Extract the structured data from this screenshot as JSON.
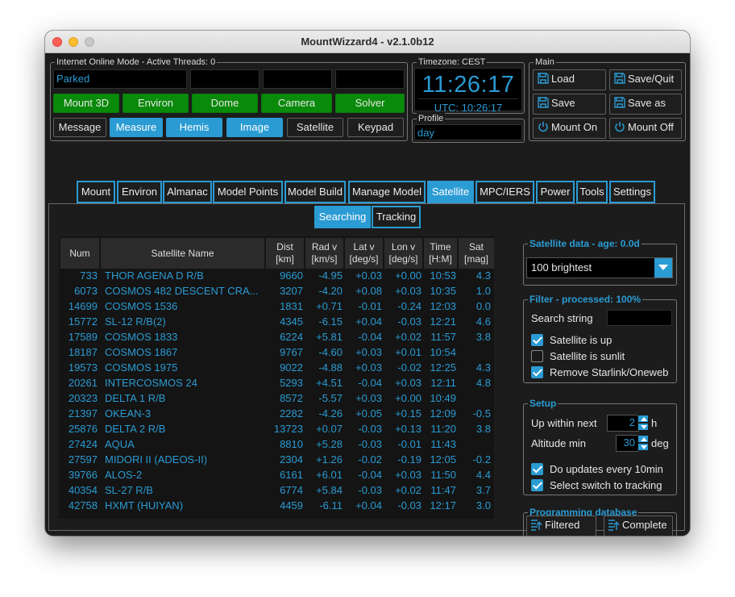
{
  "window": {
    "title": "MountWizzard4 - v2.1.0b12"
  },
  "internet": {
    "label": "Internet Online Mode  -  Active Threads:  0",
    "status": "Parked",
    "devices": [
      "Mount 3D",
      "Environ",
      "Dome",
      "Camera",
      "Solver"
    ],
    "actions": [
      {
        "label": "Message",
        "state": "normal"
      },
      {
        "label": "Measure",
        "state": "active"
      },
      {
        "label": "Hemis",
        "state": "active"
      },
      {
        "label": "Image",
        "state": "active"
      },
      {
        "label": "Satellite",
        "state": "normal"
      },
      {
        "label": "Keypad",
        "state": "normal"
      }
    ]
  },
  "timezone": {
    "label": "Timezone: CEST",
    "time": "11:26:17",
    "utc": "UTC:  10:26:17"
  },
  "profile": {
    "label": "Profile",
    "value": "day"
  },
  "main": {
    "label": "Main",
    "buttons": [
      {
        "label": "Load",
        "icon": "floppy-icon"
      },
      {
        "label": "Save/Quit",
        "icon": "floppy-icon"
      },
      {
        "label": "Save",
        "icon": "floppy-icon"
      },
      {
        "label": "Save as",
        "icon": "floppy-icon"
      },
      {
        "label": "Mount On",
        "icon": "power-icon"
      },
      {
        "label": "Mount Off",
        "icon": "power-icon"
      }
    ]
  },
  "tabs": [
    "Mount",
    "Environ",
    "Almanac",
    "Model Points",
    "Model Build",
    "Manage Model",
    "Satellite",
    "MPC/IERS",
    "Power",
    "Tools",
    "Settings"
  ],
  "active_tab": "Satellite",
  "subtabs": [
    "Searching",
    "Tracking"
  ],
  "active_subtab": "Searching",
  "table": {
    "headers": [
      "Num",
      "Satellite Name",
      "Dist\n[km]",
      "Rad v\n[km/s]",
      "Lat v\n[deg/s]",
      "Lon v\n[deg/s]",
      "Time\n[H:M]",
      "Sat\n[mag]"
    ],
    "rows": [
      [
        "733",
        "THOR AGENA D R/B",
        "9660",
        "-4.95",
        "+0.03",
        "+0.00",
        "10:53",
        "4.3"
      ],
      [
        "6073",
        "COSMOS 482 DESCENT CRA...",
        "3207",
        "-4.20",
        "+0.08",
        "+0.03",
        "10:35",
        "1.0"
      ],
      [
        "14699",
        "COSMOS 1536",
        "1831",
        "+0.71",
        "-0.01",
        "-0.24",
        "12:03",
        "0.0"
      ],
      [
        "15772",
        "SL-12 R/B(2)",
        "4345",
        "-6.15",
        "+0.04",
        "-0.03",
        "12:21",
        "4.6"
      ],
      [
        "17589",
        "COSMOS 1833",
        "6224",
        "+5.81",
        "-0.04",
        "+0.02",
        "11:57",
        "3.8"
      ],
      [
        "18187",
        "COSMOS 1867",
        "9767",
        "-4.60",
        "+0.03",
        "+0.01",
        "10:54",
        ""
      ],
      [
        "19573",
        "COSMOS 1975",
        "9022",
        "-4.88",
        "+0.03",
        "-0.02",
        "12:25",
        "4.3"
      ],
      [
        "20261",
        "INTERCOSMOS 24",
        "5293",
        "+4.51",
        "-0.04",
        "+0.03",
        "12:11",
        "4.8"
      ],
      [
        "20323",
        "DELTA 1 R/B",
        "8572",
        "-5.57",
        "+0.03",
        "+0.00",
        "10:49",
        ""
      ],
      [
        "21397",
        "OKEAN-3",
        "2282",
        "-4.26",
        "+0.05",
        "+0.15",
        "12:09",
        "-0.5"
      ],
      [
        "25876",
        "DELTA 2 R/B",
        "13723",
        "+0.07",
        "-0.03",
        "+0.13",
        "11:20",
        "3.8"
      ],
      [
        "27424",
        "AQUA",
        "8810",
        "+5.28",
        "-0.03",
        "-0.01",
        "11:43",
        ""
      ],
      [
        "27597",
        "MIDORI II (ADEOS-II)",
        "2304",
        "+1.26",
        "-0.02",
        "-0.19",
        "12:05",
        "-0.2"
      ],
      [
        "39766",
        "ALOS-2",
        "6161",
        "+6.01",
        "-0.04",
        "+0.03",
        "11:50",
        "4.4"
      ],
      [
        "40354",
        "SL-27 R/B",
        "6774",
        "+5.84",
        "-0.03",
        "+0.02",
        "11:47",
        "3.7"
      ],
      [
        "42758",
        "HXMT (HUIYAN)",
        "4459",
        "-6.11",
        "+0.04",
        "-0.03",
        "12:17",
        "3.0"
      ]
    ]
  },
  "satdata": {
    "label": "Satellite data - age: 0.0d",
    "selected": "100 brightest"
  },
  "filter": {
    "label": "Filter - processed: 100%",
    "search_label": "Search string",
    "search_value": "",
    "options": [
      {
        "label": "Satellite is up",
        "checked": true
      },
      {
        "label": "Satellite is sunlit",
        "checked": false
      },
      {
        "label": "Remove Starlink/Oneweb",
        "checked": true
      }
    ]
  },
  "setup": {
    "label": "Setup",
    "up_within_label": "Up within next",
    "up_within_value": "2",
    "up_within_unit": "h",
    "altitude_label": "Altitude min",
    "altitude_value": "30",
    "altitude_unit": "deg",
    "options": [
      {
        "label": "Do updates every 10min",
        "checked": true
      },
      {
        "label": "Select switch to tracking",
        "checked": true
      }
    ]
  },
  "programming": {
    "label": "Programming database",
    "filtered_label": "Filtered",
    "complete_label": "Complete"
  },
  "colors": {
    "accent": "#2a9bd3",
    "green": "#0a8a0a",
    "background": "#1c1c1c"
  }
}
